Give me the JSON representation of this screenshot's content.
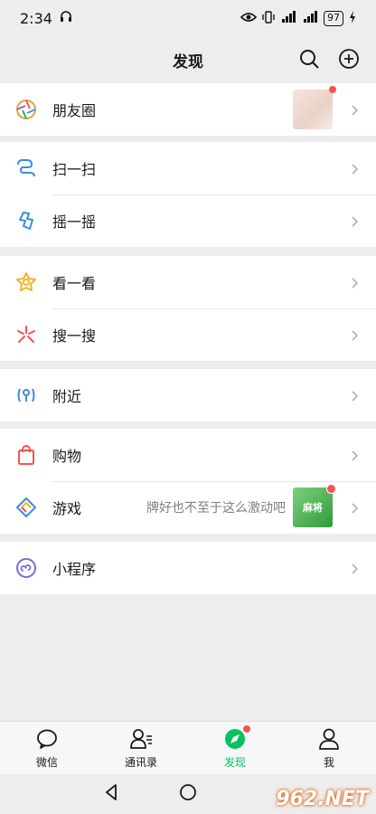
{
  "status_bar": {
    "time": "2:34",
    "battery": "97"
  },
  "header": {
    "title": "发现"
  },
  "groups": [
    {
      "items": [
        {
          "label": "朋友圈"
        }
      ]
    },
    {
      "items": [
        {
          "label": "扫一扫"
        },
        {
          "label": "摇一摇"
        }
      ]
    },
    {
      "items": [
        {
          "label": "看一看"
        },
        {
          "label": "搜一搜"
        }
      ]
    },
    {
      "items": [
        {
          "label": "附近"
        }
      ]
    },
    {
      "items": [
        {
          "label": "购物"
        },
        {
          "label": "游戏",
          "sub": "牌好也不至于这么激动吧",
          "thumb_text": "麻将"
        }
      ]
    },
    {
      "items": [
        {
          "label": "小程序"
        }
      ]
    }
  ],
  "tabs": [
    {
      "label": "微信",
      "icon": "chat-icon"
    },
    {
      "label": "通讯录",
      "icon": "contacts-icon"
    },
    {
      "label": "发现",
      "icon": "discover-icon",
      "active": true
    },
    {
      "label": "我",
      "icon": "me-icon"
    }
  ],
  "watermark": "962.NET",
  "colors": {
    "accent": "#07c160",
    "badge": "#fa5151",
    "background": "#ededed"
  }
}
